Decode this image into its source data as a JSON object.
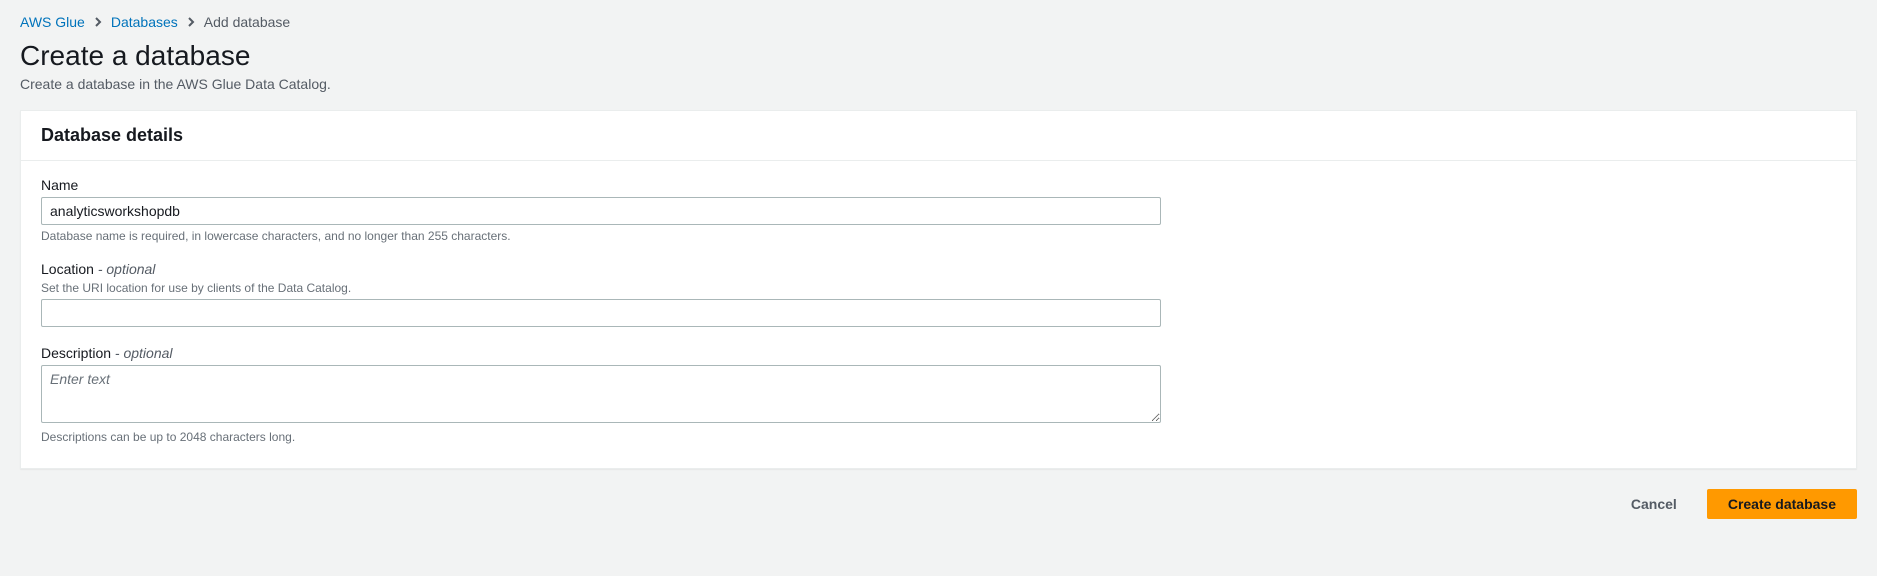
{
  "breadcrumb": {
    "items": [
      {
        "label": "AWS Glue"
      },
      {
        "label": "Databases"
      }
    ],
    "current": "Add database"
  },
  "header": {
    "title": "Create a database",
    "subtitle": "Create a database in the AWS Glue Data Catalog."
  },
  "panel": {
    "title": "Database details",
    "fields": {
      "name": {
        "label": "Name",
        "value": "analyticsworkshopdb",
        "hint": "Database name is required, in lowercase characters, and no longer than 255 characters."
      },
      "location": {
        "label": "Location",
        "optional": "- optional",
        "hint_above": "Set the URI location for use by clients of the Data Catalog.",
        "value": ""
      },
      "description": {
        "label": "Description",
        "optional": "- optional",
        "placeholder": "Enter text",
        "value": "",
        "hint": "Descriptions can be up to 2048 characters long."
      }
    }
  },
  "actions": {
    "cancel": "Cancel",
    "submit": "Create database"
  }
}
